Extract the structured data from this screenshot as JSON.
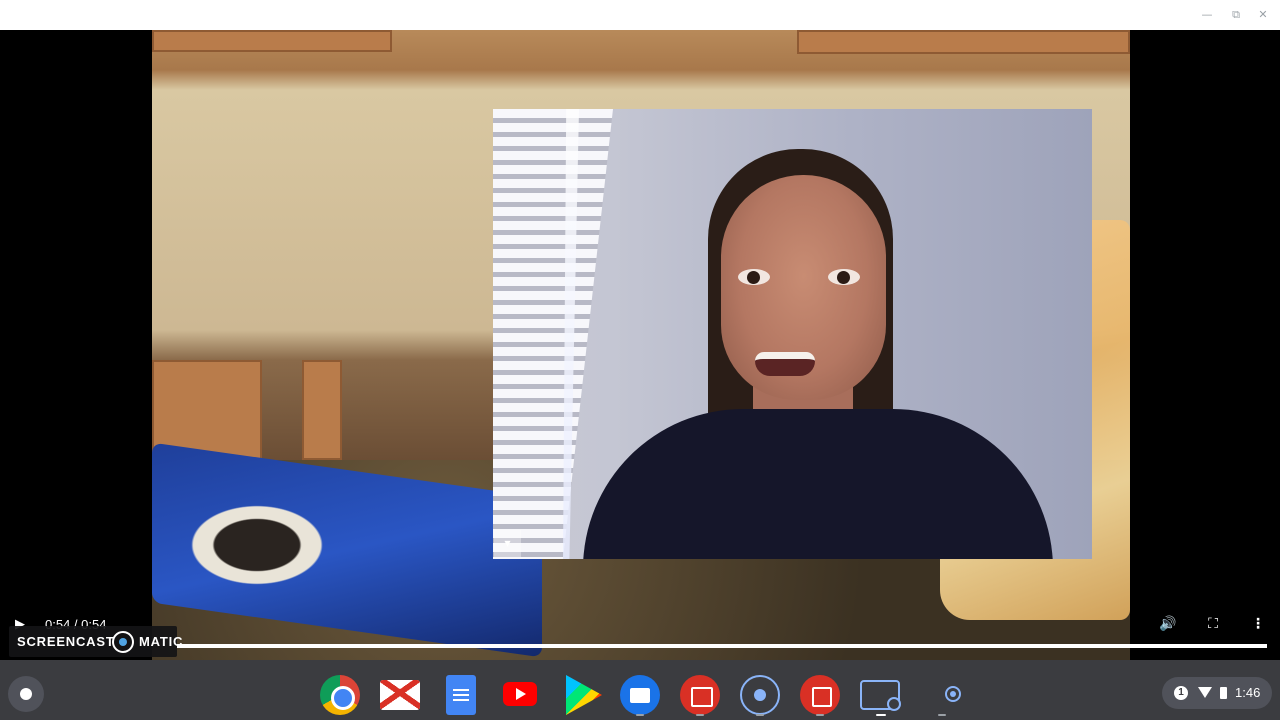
{
  "window": {
    "controls": {
      "minimize_glyph": "—",
      "maximize_glyph": "⧉",
      "close_glyph": "✕"
    }
  },
  "video": {
    "current_time": "0:54",
    "duration": "0:54",
    "time_display": "0:54 / 0:54",
    "progress_fraction": 1.0,
    "pip_toggle_glyph": "▾",
    "play_glyph": "▶",
    "volume_glyph": "🔊",
    "fullscreen_glyph": "⛶",
    "more_glyph": "⋮"
  },
  "watermark": {
    "left_text": "SCREENCAST",
    "right_text": "MATIC"
  },
  "shelf": {
    "apps": [
      {
        "name": "chrome-icon"
      },
      {
        "name": "gmail-icon"
      },
      {
        "name": "docs-icon"
      },
      {
        "name": "youtube-icon"
      },
      {
        "name": "play-store-icon"
      },
      {
        "name": "files-icon"
      },
      {
        "name": "video-editor-icon"
      },
      {
        "name": "screencast-icon"
      },
      {
        "name": "gallery-icon"
      },
      {
        "name": "screen-recorder-icon"
      },
      {
        "name": "record-icon"
      }
    ],
    "status": {
      "notification_count": "1",
      "time": "1:46"
    }
  },
  "colors": {
    "shelf_bg": "#3b3c40",
    "accent": "#8ab4f8",
    "watermark_dot": "#4fa3e3"
  }
}
